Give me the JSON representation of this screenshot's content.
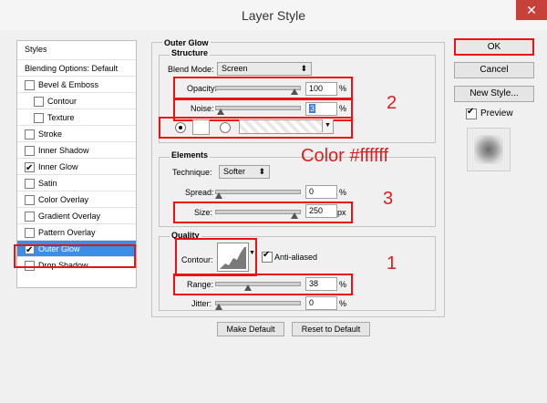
{
  "window": {
    "title": "Layer Style",
    "close": "✕"
  },
  "left": {
    "header": "Styles",
    "items": [
      {
        "label": "Blending Options: Default"
      },
      {
        "label": "Bevel & Emboss",
        "checked": false
      },
      {
        "label": "Contour",
        "checked": false
      },
      {
        "label": "Texture",
        "checked": false
      },
      {
        "label": "Stroke",
        "checked": false
      },
      {
        "label": "Inner Shadow",
        "checked": false
      },
      {
        "label": "Inner Glow",
        "checked": true
      },
      {
        "label": "Satin",
        "checked": false
      },
      {
        "label": "Color Overlay",
        "checked": false
      },
      {
        "label": "Gradient Overlay",
        "checked": false
      },
      {
        "label": "Pattern Overlay",
        "checked": false
      },
      {
        "label": "Outer Glow",
        "checked": true
      },
      {
        "label": "Drop Shadow",
        "checked": false
      }
    ]
  },
  "outer_glow": {
    "title": "Outer Glow",
    "structure": {
      "title": "Structure",
      "blend_mode_label": "Blend Mode:",
      "blend_mode_value": "Screen",
      "opacity_label": "Opacity:",
      "opacity_value": "100",
      "opacity_unit": "%",
      "noise_label": "Noise:",
      "noise_value": "3",
      "noise_unit": "%",
      "color": "#ffffff"
    },
    "elements": {
      "title": "Elements",
      "technique_label": "Technique:",
      "technique_value": "Softer",
      "spread_label": "Spread:",
      "spread_value": "0",
      "spread_unit": "%",
      "size_label": "Size:",
      "size_value": "250",
      "size_unit": "px"
    },
    "quality": {
      "title": "Quality",
      "contour_label": "Contour:",
      "anti_aliased_label": "Anti-aliased",
      "anti_aliased_checked": true,
      "range_label": "Range:",
      "range_value": "38",
      "range_unit": "%",
      "jitter_label": "Jitter:",
      "jitter_value": "0",
      "jitter_unit": "%"
    },
    "make_default": "Make Default",
    "reset_default": "Reset to Default"
  },
  "right": {
    "ok": "OK",
    "cancel": "Cancel",
    "new_style": "New Style...",
    "preview_label": "Preview",
    "preview_checked": true
  },
  "annotations": {
    "n2": "2",
    "color_text": "Color #ffffff",
    "n3": "3",
    "n1": "1"
  }
}
